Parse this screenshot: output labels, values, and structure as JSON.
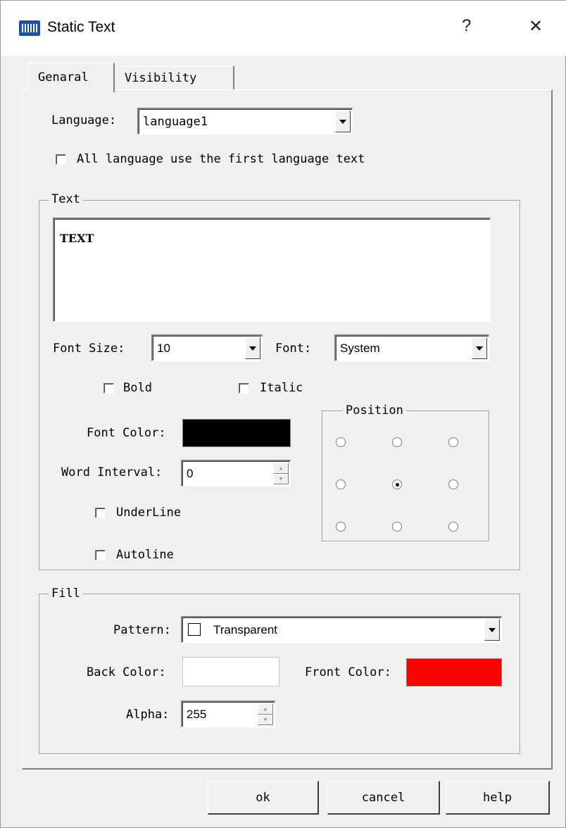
{
  "window": {
    "title": "Static Text",
    "help_glyph": "?",
    "close_glyph": "✕"
  },
  "tabs": [
    {
      "label": "Genaral"
    },
    {
      "label": "Visibility"
    }
  ],
  "general": {
    "language_label": "Language:",
    "language_value": "language1",
    "all_language_label": "All language use the first language text",
    "all_language_checked": false
  },
  "text_group": {
    "legend": "Text",
    "text_value": "TEXT",
    "font_size_label": "Font Size:",
    "font_size_value": "10",
    "font_label": "Font:",
    "font_value": "System",
    "bold_label": "Bold",
    "italic_label": "Italic",
    "font_color_label": "Font Color:",
    "font_color": "#000000",
    "word_interval_label": "Word Interval:",
    "word_interval_value": "0",
    "underline_label": "UnderLine",
    "autoline_label": "Autoline",
    "position_legend": "Position",
    "position_selected": "middle-center"
  },
  "fill_group": {
    "legend": "Fill",
    "pattern_label": "Pattern:",
    "pattern_value": "Transparent",
    "back_color_label": "Back Color:",
    "back_color": "#ffffff",
    "front_color_label": "Front Color:",
    "front_color": "#ff0000",
    "alpha_label": "Alpha:",
    "alpha_value": "255"
  },
  "buttons": {
    "ok": "ok",
    "cancel": "cancel",
    "help": "help"
  }
}
